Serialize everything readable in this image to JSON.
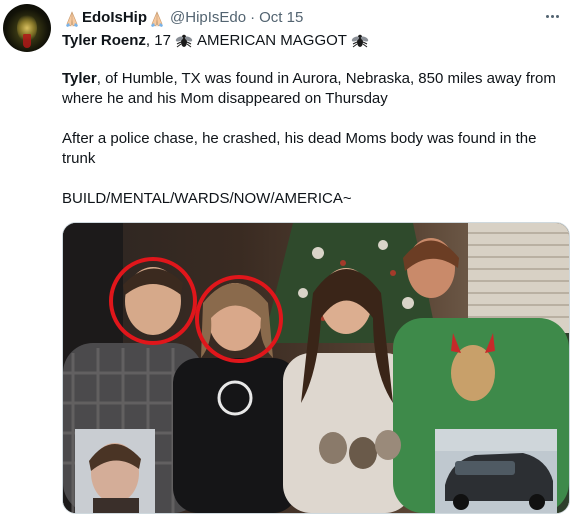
{
  "tweet": {
    "display_name": "EdoIsHip",
    "handle": "@HipIsEdo",
    "separator": "·",
    "time": "Oct 15",
    "subject_name": "Tyler Roenz",
    "subject_age": ", 17",
    "subject_tag": "AMERICAN MAGGOT",
    "body": {
      "p1_name": "Tyler",
      "p1_rest": ", of Humble, TX was found in Aurora, Nebraska, 850 miles away from where he and his Mom disappeared on Thursday",
      "p2": "After a police chase, he crashed, his dead Moms body was found in the trunk",
      "p3": "BUILD/MENTAL/WARDS/NOW/AMERICA~"
    },
    "media": {
      "photo_description_icon": "family-photo",
      "highlight_color": "#e0161b",
      "inset_left_icon": "mugshot-photo",
      "inset_right_icon": "car-photo"
    }
  }
}
